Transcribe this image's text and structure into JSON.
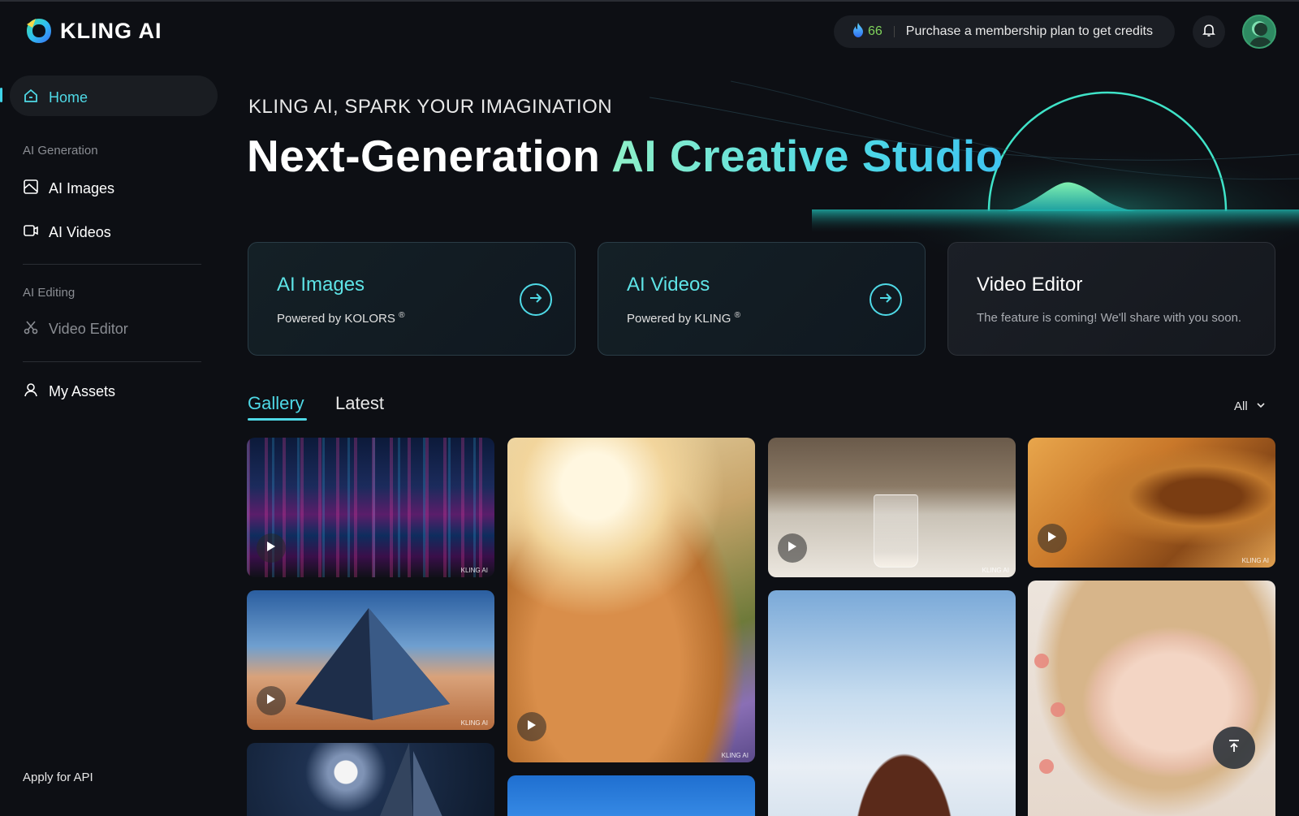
{
  "header": {
    "logo_text": "KLING AI",
    "credits": "66",
    "membership_text": "Purchase a membership plan to get credits",
    "accent_color": "#4fd9e6"
  },
  "sidebar": {
    "home_label": "Home",
    "section_generation": "AI Generation",
    "ai_images_label": "AI Images",
    "ai_videos_label": "AI Videos",
    "section_editing": "AI Editing",
    "video_editor_label": "Video Editor",
    "my_assets_label": "My Assets",
    "apply_api_label": "Apply for API"
  },
  "hero": {
    "subtitle": "KLING AI, SPARK YOUR IMAGINATION",
    "title_white": "Next-Generation ",
    "title_gradient": "AI Creative Studio"
  },
  "cards": [
    {
      "title": "AI Images",
      "subtitle": "Powered by KOLORS",
      "mark": "®",
      "icon": "arrow-right-icon"
    },
    {
      "title": "AI Videos",
      "subtitle": "Powered by KLING",
      "mark": "®",
      "icon": "arrow-right-icon"
    },
    {
      "title": "Video Editor",
      "subtitle": "The feature is coming! We'll share with you soon."
    }
  ],
  "tabs": {
    "gallery": "Gallery",
    "latest": "Latest",
    "filter_value": "All"
  },
  "gallery": {
    "watermark": "KLING AI"
  }
}
